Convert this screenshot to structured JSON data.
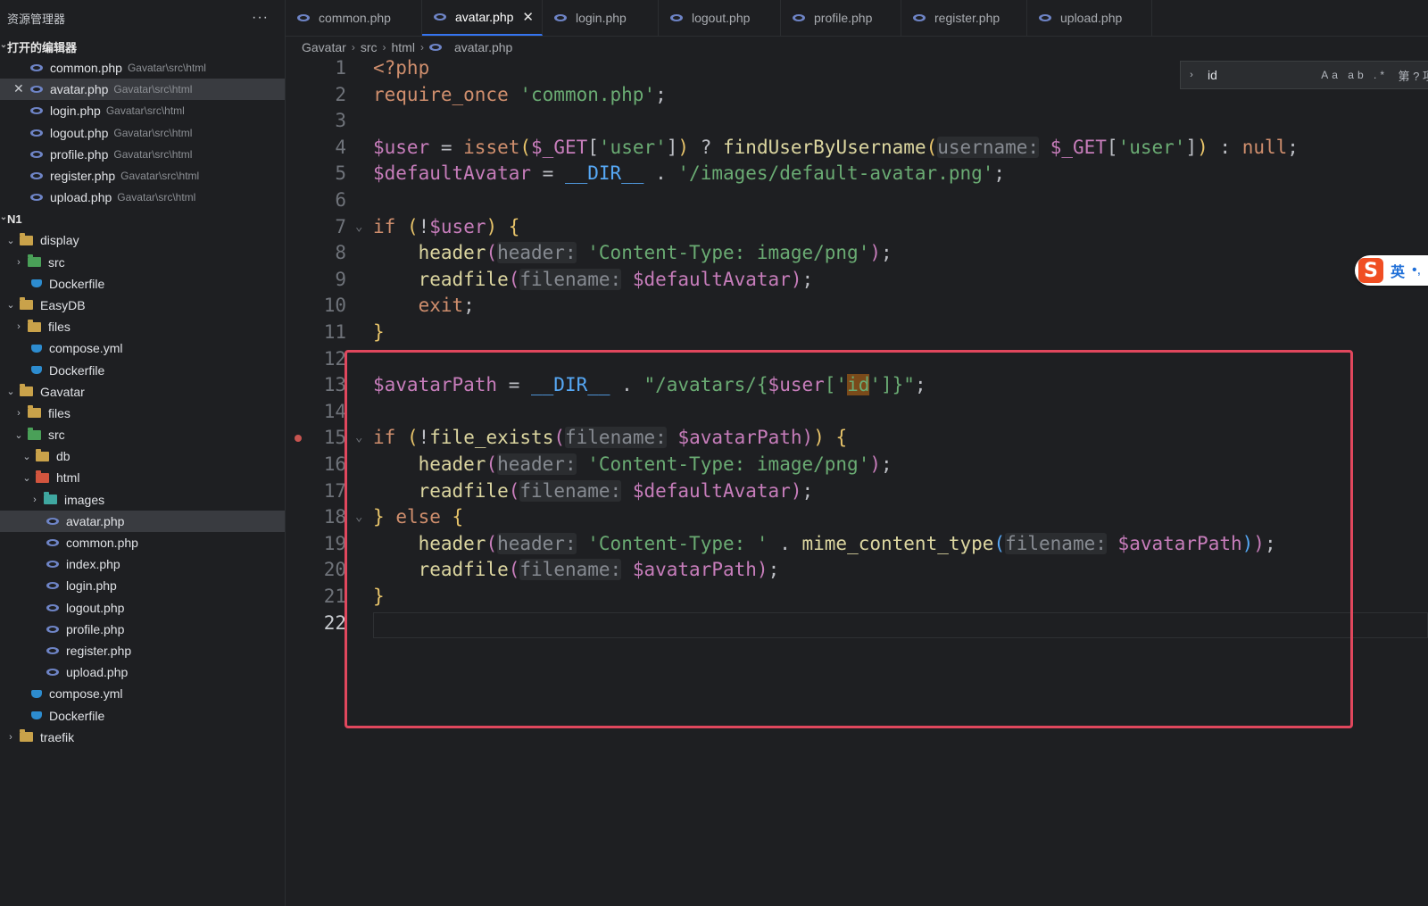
{
  "sidebar": {
    "title": "资源管理器",
    "more": "···",
    "open_editors_title": "打开的编辑器",
    "open_editors": [
      {
        "name": "common.php",
        "path": "Gavatar\\src\\html"
      },
      {
        "name": "avatar.php",
        "path": "Gavatar\\src\\html",
        "close": "✕"
      },
      {
        "name": "login.php",
        "path": "Gavatar\\src\\html"
      },
      {
        "name": "logout.php",
        "path": "Gavatar\\src\\html"
      },
      {
        "name": "profile.php",
        "path": "Gavatar\\src\\html"
      },
      {
        "name": "register.php",
        "path": "Gavatar\\src\\html"
      },
      {
        "name": "upload.php",
        "path": "Gavatar\\src\\html"
      }
    ],
    "workspace_title": "N1",
    "tree": {
      "display": "display",
      "display_src": "src",
      "display_dockerfile": "Dockerfile",
      "easydb": "EasyDB",
      "easydb_files": "files",
      "easydb_compose": "compose.yml",
      "easydb_dockerfile": "Dockerfile",
      "gavatar": "Gavatar",
      "gavatar_files": "files",
      "gavatar_src": "src",
      "db": "db",
      "html": "html",
      "images": "images",
      "html_files": [
        "avatar.php",
        "common.php",
        "index.php",
        "login.php",
        "logout.php",
        "profile.php",
        "register.php",
        "upload.php"
      ],
      "gavatar_compose": "compose.yml",
      "gavatar_dockerfile": "Dockerfile",
      "traefik": "traefik"
    }
  },
  "tabs": [
    {
      "label": "common.php"
    },
    {
      "label": "avatar.php",
      "close": "✕"
    },
    {
      "label": "login.php"
    },
    {
      "label": "logout.php"
    },
    {
      "label": "profile.php"
    },
    {
      "label": "register.php"
    },
    {
      "label": "upload.php"
    }
  ],
  "breadcrumb": [
    "Gavatar",
    "src",
    "html",
    "avatar.php"
  ],
  "find": {
    "value": "id",
    "options": "Aa ab .*",
    "result": "第 ? 项"
  },
  "ime": {
    "lang": "英"
  },
  "line_numbers": [
    "1",
    "2",
    "3",
    "4",
    "5",
    "6",
    "7",
    "8",
    "9",
    "10",
    "11",
    "12",
    "13",
    "14",
    "15",
    "16",
    "17",
    "18",
    "19",
    "20",
    "21",
    "22"
  ],
  "colors": {
    "highlight_box": "#e0475d",
    "accent": "#3574f0"
  }
}
